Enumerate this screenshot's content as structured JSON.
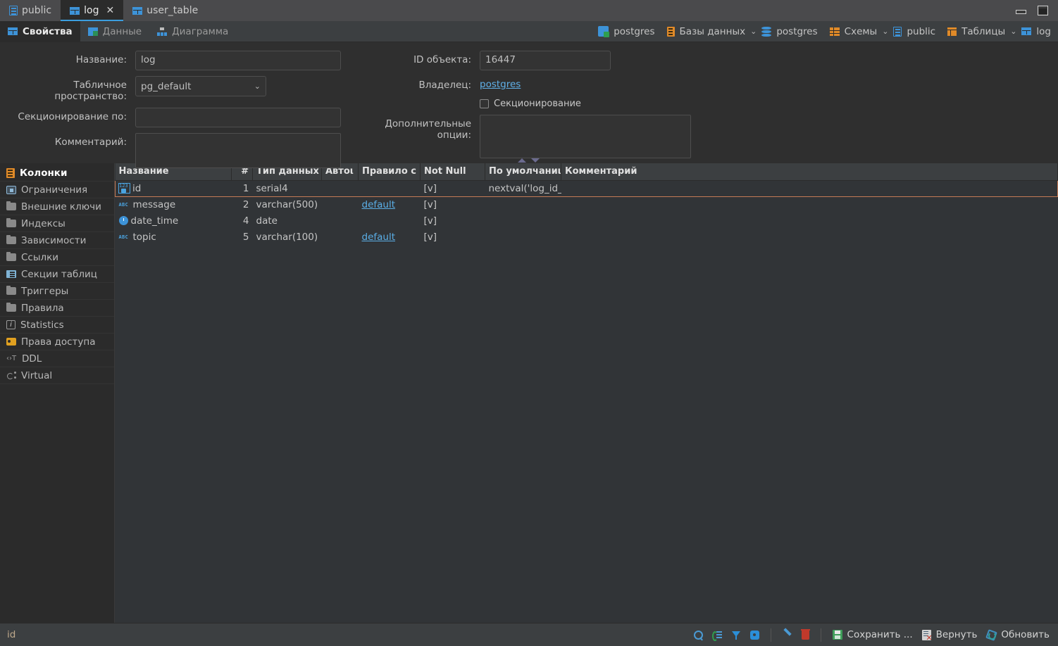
{
  "window": {
    "tabs": [
      {
        "label": "public",
        "icon": "schema-icon",
        "active": false,
        "closable": false
      },
      {
        "label": "log",
        "icon": "table-icon",
        "active": true,
        "closable": true
      },
      {
        "label": "user_table",
        "icon": "table-icon",
        "active": false,
        "closable": false
      }
    ],
    "controls": {
      "minimize": "minimize-button",
      "maximize": "maximize-button"
    }
  },
  "subtabs": [
    {
      "label": "Свойства",
      "icon": "table-icon",
      "active": true
    },
    {
      "label": "Данные",
      "icon": "data-icon",
      "active": false
    },
    {
      "label": "Диаграмма",
      "icon": "diagram-icon",
      "active": false
    }
  ],
  "breadcrumbs": [
    {
      "label": "postgres",
      "icon": "postgres-icon",
      "chevron": false
    },
    {
      "label": "Базы данных",
      "icon": "db-list-icon",
      "chevron": true
    },
    {
      "label": "postgres",
      "icon": "database-icon",
      "chevron": false
    },
    {
      "label": "Схемы",
      "icon": "schemes-icon",
      "chevron": true
    },
    {
      "label": "public",
      "icon": "schema-icon",
      "chevron": false
    },
    {
      "label": "Таблицы",
      "icon": "tables-icon",
      "chevron": true
    },
    {
      "label": "log",
      "icon": "table-icon",
      "chevron": false
    }
  ],
  "form": {
    "name_label": "Название:",
    "name_value": "log",
    "tablespace_label": "Табличное пространство:",
    "tablespace_value": "pg_default",
    "partition_by_label": "Секционирование по:",
    "partition_by_value": "",
    "comment_label": "Комментарий:",
    "comment_value": "",
    "object_id_label": "ID объекта:",
    "object_id_value": "16447",
    "owner_label": "Владелец:",
    "owner_value": "postgres",
    "partitioning_checkbox_label": "Секционирование",
    "partitioning_checked": false,
    "extra_options_label": "Дополнительные опции:",
    "extra_options_value": ""
  },
  "sidebar": {
    "items": [
      {
        "label": "Колонки",
        "icon": "columns-icon",
        "active": true
      },
      {
        "label": "Ограничения",
        "icon": "constraints-icon",
        "active": false
      },
      {
        "label": "Внешние ключи",
        "icon": "folder-icon",
        "active": false
      },
      {
        "label": "Индексы",
        "icon": "folder-icon",
        "active": false
      },
      {
        "label": "Зависимости",
        "icon": "folder-icon",
        "active": false
      },
      {
        "label": "Ссылки",
        "icon": "folder-icon",
        "active": false
      },
      {
        "label": "Секции таблиц",
        "icon": "sections-icon",
        "active": false
      },
      {
        "label": "Триггеры",
        "icon": "folder-icon",
        "active": false
      },
      {
        "label": "Правила",
        "icon": "folder-icon",
        "active": false
      },
      {
        "label": "Statistics",
        "icon": "info-icon",
        "active": false
      },
      {
        "label": "Права доступа",
        "icon": "key-icon",
        "active": false
      },
      {
        "label": "DDL",
        "icon": "ddl-icon",
        "active": false
      },
      {
        "label": "Virtual",
        "icon": "virtual-icon",
        "active": false
      }
    ]
  },
  "grid": {
    "columns": [
      {
        "key": "name",
        "label": "Название"
      },
      {
        "key": "num",
        "label": "#"
      },
      {
        "key": "datatype",
        "label": "Тип данных"
      },
      {
        "key": "autoincrement",
        "label": "Автоι"
      },
      {
        "key": "collation",
        "label": "Правило с"
      },
      {
        "key": "notnull",
        "label": "Not Null"
      },
      {
        "key": "default",
        "label": "По умолчаниι"
      },
      {
        "key": "comment",
        "label": "Комментарий"
      }
    ],
    "rows": [
      {
        "name": "id",
        "icon": "numeric-key-icon",
        "num": "1",
        "datatype": "serial4",
        "autoincrement": "",
        "collation": "",
        "notnull": "[v]",
        "default": "nextval('log_id_",
        "comment": "",
        "selected": true
      },
      {
        "name": "message",
        "icon": "text-icon",
        "num": "2",
        "datatype": "varchar(500)",
        "autoincrement": "",
        "collation": "default",
        "notnull": "[v]",
        "default": "",
        "comment": "",
        "selected": false
      },
      {
        "name": "date_time",
        "icon": "clock-icon",
        "num": "4",
        "datatype": "date",
        "autoincrement": "",
        "collation": "",
        "notnull": "[v]",
        "default": "",
        "comment": "",
        "selected": false
      },
      {
        "name": "topic",
        "icon": "text-icon",
        "num": "5",
        "datatype": "varchar(100)",
        "autoincrement": "",
        "collation": "default",
        "notnull": "[v]",
        "default": "",
        "comment": "",
        "selected": false
      }
    ]
  },
  "statusbar": {
    "text": "id",
    "tools": [
      {
        "name": "search-icon",
        "label": ""
      },
      {
        "name": "filter-list-icon",
        "label": ""
      },
      {
        "name": "funnel-icon",
        "label": ""
      },
      {
        "name": "gear-icon",
        "label": ""
      },
      {
        "name": "pencil-icon",
        "label": ""
      },
      {
        "name": "trash-icon",
        "label": ""
      }
    ],
    "save_label": "Сохранить ...",
    "revert_label": "Вернуть",
    "refresh_label": "Обновить"
  },
  "colors": {
    "accent_blue": "#3d93d8",
    "accent_orange": "#e08a28",
    "selection_border": "#c47a55",
    "link": "#5aaee6",
    "titlebar": "#4a4a4c",
    "panel": "#2f2f2f",
    "grid_bg": "#313437"
  }
}
